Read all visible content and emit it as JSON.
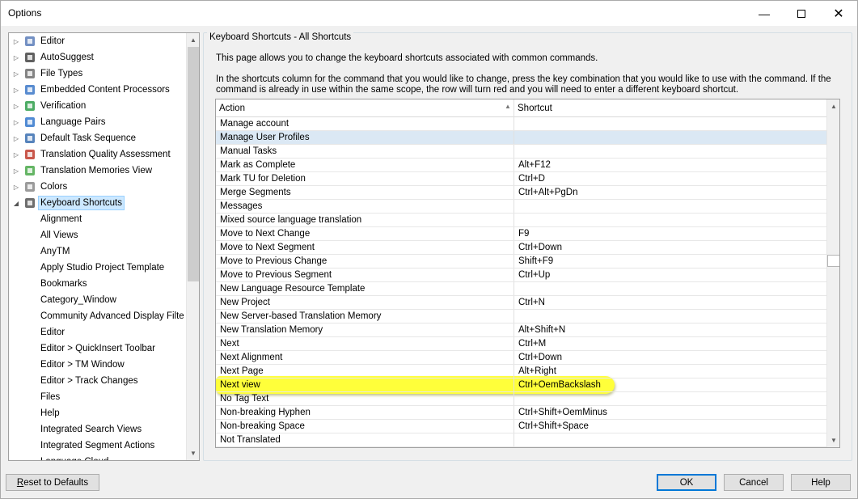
{
  "window": {
    "title": "Options"
  },
  "tree": {
    "items": [
      {
        "label": "Editor",
        "icon": "pencil-icon",
        "color": "#5b7db8"
      },
      {
        "label": "AutoSuggest",
        "icon": "autosuggest-icon",
        "color": "#444444"
      },
      {
        "label": "File Types",
        "icon": "file-icon",
        "color": "#6f6f6f"
      },
      {
        "label": "Embedded Content Processors",
        "icon": "embedded-icon",
        "color": "#3c78c8"
      },
      {
        "label": "Verification",
        "icon": "verification-icon",
        "color": "#2e9e4a"
      },
      {
        "label": "Language Pairs",
        "icon": "language-pairs-icon",
        "color": "#3377cc"
      },
      {
        "label": "Default Task Sequence",
        "icon": "task-sequence-icon",
        "color": "#3a6fb0"
      },
      {
        "label": "Translation Quality Assessment",
        "icon": "quality-icon",
        "color": "#c0392b"
      },
      {
        "label": "Translation Memories View",
        "icon": "memories-icon",
        "color": "#4aa84a"
      },
      {
        "label": "Colors",
        "icon": "palette-icon",
        "color": "#8a8a8a"
      },
      {
        "label": "Keyboard Shortcuts",
        "icon": "keyboard-icon",
        "color": "#555555"
      }
    ],
    "children": [
      "Alignment",
      "All Views",
      "AnyTM",
      "Apply Studio Project Template",
      "Bookmarks",
      "Category_Window",
      "Community Advanced Display Filte",
      "Editor",
      "Editor > QuickInsert Toolbar",
      "Editor > TM Window",
      "Editor > Track Changes",
      "Files",
      "Help",
      "Integrated Search Views",
      "Integrated Segment Actions",
      "Language Cloud"
    ]
  },
  "panel": {
    "title": "Keyboard Shortcuts - All Shortcuts",
    "description1": "This page allows you to change the keyboard shortcuts associated with common commands.",
    "description2": "In the shortcuts column for the command that you would like to change, press the key combination that you would like to use with the command.  If the command is already in use within the same scope, the row will turn red and you will need to enter a different keyboard shortcut."
  },
  "grid": {
    "col_action": "Action",
    "col_shortcut": "Shortcut",
    "rows": [
      {
        "action": "Manage account",
        "shortcut": ""
      },
      {
        "action": "Manage User Profiles",
        "shortcut": ""
      },
      {
        "action": "Manual Tasks",
        "shortcut": ""
      },
      {
        "action": "Mark as Complete",
        "shortcut": "Alt+F12"
      },
      {
        "action": "Mark TU for Deletion",
        "shortcut": "Ctrl+D"
      },
      {
        "action": "Merge Segments",
        "shortcut": "Ctrl+Alt+PgDn"
      },
      {
        "action": "Messages",
        "shortcut": ""
      },
      {
        "action": "Mixed source language translation",
        "shortcut": ""
      },
      {
        "action": "Move to Next Change",
        "shortcut": "F9"
      },
      {
        "action": "Move to Next Segment",
        "shortcut": "Ctrl+Down"
      },
      {
        "action": "Move to Previous Change",
        "shortcut": "Shift+F9"
      },
      {
        "action": "Move to Previous Segment",
        "shortcut": "Ctrl+Up"
      },
      {
        "action": "New Language Resource Template",
        "shortcut": ""
      },
      {
        "action": "New Project",
        "shortcut": "Ctrl+N"
      },
      {
        "action": "New Server-based Translation Memory",
        "shortcut": ""
      },
      {
        "action": "New Translation Memory",
        "shortcut": "Alt+Shift+N"
      },
      {
        "action": "Next",
        "shortcut": "Ctrl+M"
      },
      {
        "action": "Next Alignment",
        "shortcut": "Ctrl+Down"
      },
      {
        "action": "Next Page",
        "shortcut": "Alt+Right"
      },
      {
        "action": "Next view",
        "shortcut": "Ctrl+OemBackslash"
      },
      {
        "action": "No Tag Text",
        "shortcut": ""
      },
      {
        "action": "Non-breaking Hyphen",
        "shortcut": "Ctrl+Shift+OemMinus"
      },
      {
        "action": "Non-breaking Space",
        "shortcut": "Ctrl+Shift+Space"
      },
      {
        "action": "Not Translated",
        "shortcut": ""
      }
    ]
  },
  "buttons": {
    "reset_first": "R",
    "reset_rest": "eset to Defaults",
    "ok": "OK",
    "cancel": "Cancel",
    "help": "Help"
  },
  "colors": {
    "selection": "#cce8ff",
    "row_highlight": "#dbe8f4",
    "marker_yellow": "#ffff3a",
    "default_button_border": "#0078d7"
  }
}
